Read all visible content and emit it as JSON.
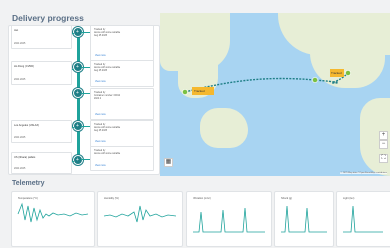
{
  "progress_title": "Delivery progress",
  "telemetry_title": "Telemetry",
  "stops": [
    {
      "name": "Jan",
      "date": "2024 2025"
    },
    {
      "name": "Ho Dong (CVND)",
      "date": "2024 2025"
    },
    {
      "name": "Los Angeles (USLAX)",
      "date": "2024 2025"
    },
    {
      "name": "US (Ithaca) pallets",
      "date": "2024 2025"
    }
  ],
  "events": [
    {
      "lines": [
        "Tracked by",
        "device with some suitable",
        "Aug 25 2025"
      ],
      "view": "View more"
    },
    {
      "lines": [
        "Tracked by",
        "device with some suitable",
        "Aug 25 2025"
      ],
      "view": "View more"
    },
    {
      "lines": [
        "Tracked by",
        "Container number: 00012",
        "2024 2"
      ],
      "view": "View more"
    },
    {
      "lines": [
        "Tracked by",
        "device with some suitable",
        "Aug 25 2025"
      ],
      "view": "View more"
    },
    {
      "lines": [
        "Tracked by",
        "device with some suitable",
        "Aug 25 2025"
      ],
      "view": "View more"
    }
  ],
  "map": {
    "callout_left": "Tracked",
    "callout_right": "Tracked",
    "attribution": "© 2025 Map data ©OpenStreetMap contributors",
    "zoom_in": "+",
    "zoom_out": "−"
  },
  "telemetry": [
    {
      "label": "Temperature (°C)"
    },
    {
      "label": "Humidity (%)"
    },
    {
      "label": "Vibration (m/s²)"
    },
    {
      "label": "Shock (g)"
    },
    {
      "label": "Light (lux)"
    }
  ]
}
